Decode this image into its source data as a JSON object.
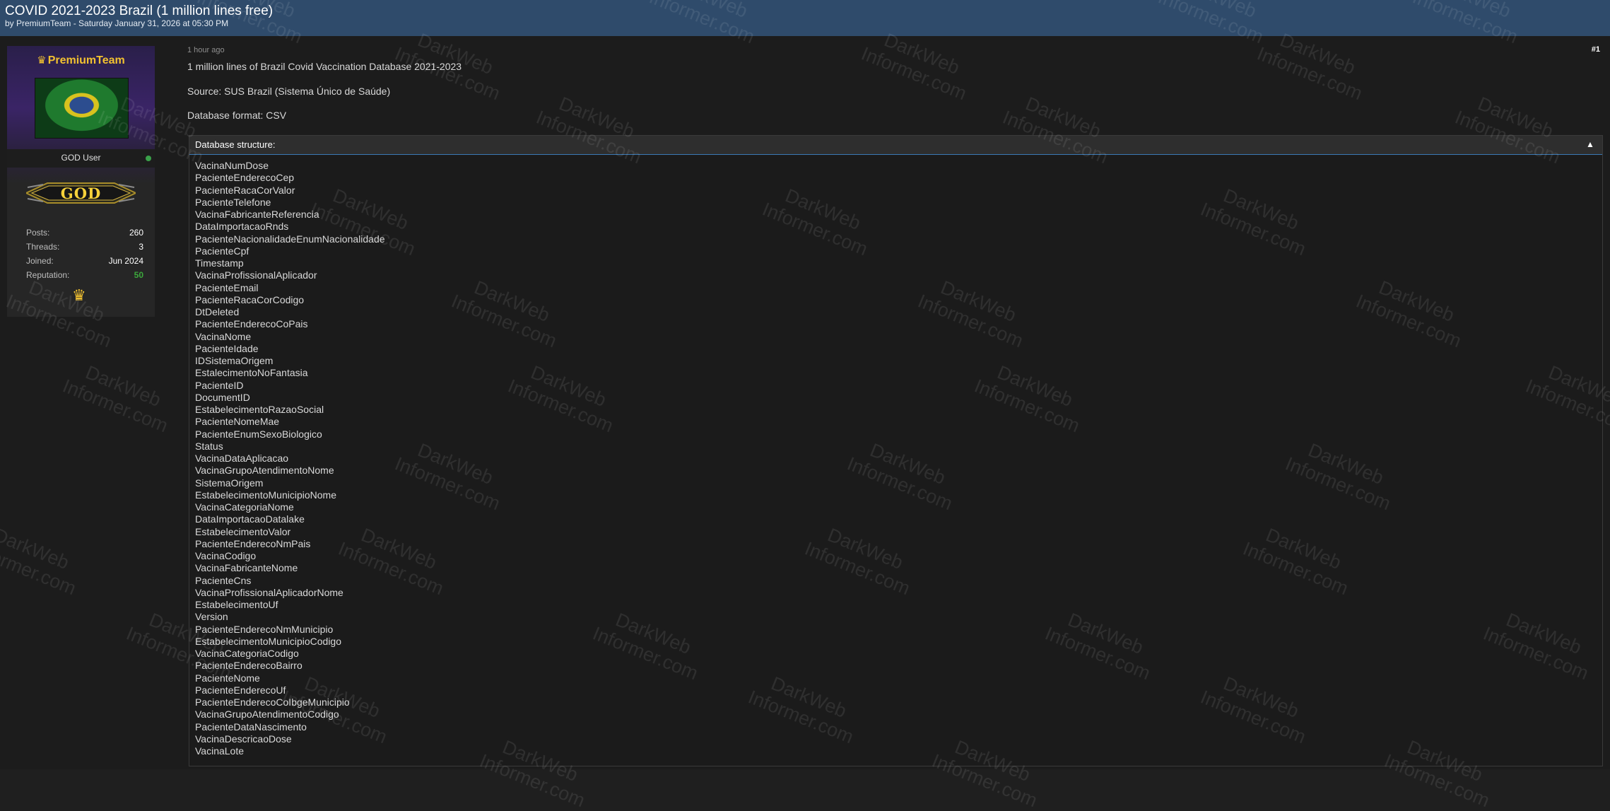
{
  "thread": {
    "title": "COVID 2021-2023 Brazil (1 million lines free)",
    "byline": "by PremiumTeam - Saturday January 31, 2026 at 05:30 PM"
  },
  "user": {
    "crown_icon": "crown-icon",
    "name": "PremiumTeam",
    "rank": "GOD User",
    "badge": "GOD",
    "online_color": "#3aa14a",
    "stats": [
      {
        "label": "Posts:",
        "value": "260"
      },
      {
        "label": "Threads:",
        "value": "3"
      },
      {
        "label": "Joined:",
        "value": "Jun 2024"
      },
      {
        "label": "Reputation:",
        "value": "50"
      }
    ]
  },
  "post": {
    "time": "1 hour ago",
    "number": "#1",
    "lines": [
      "1 million lines of Brazil Covid Vaccination Database 2021-2023",
      "Source: SUS Brazil (Sistema Único de Saúde)",
      "Database format: CSV"
    ],
    "spoiler_title": "Database structure:",
    "fields": [
      "VacinaNumDose",
      "PacienteEnderecoCep",
      "PacienteRacaCorValor",
      "PacienteTelefone",
      "VacinaFabricanteReferencia",
      "DataImportacaoRnds",
      "PacienteNacionalidadeEnumNacionalidade",
      "PacienteCpf",
      "Timestamp",
      "VacinaProfissionalAplicador",
      "PacienteEmail",
      "PacienteRacaCorCodigo",
      "DtDeleted",
      "PacienteEnderecoCoPais",
      "VacinaNome",
      "PacienteIdade",
      "IDSistemaOrigem",
      "EstalecimentoNoFantasia",
      "PacienteID",
      "DocumentID",
      "EstabelecimentoRazaoSocial",
      "PacienteNomeMae",
      "PacienteEnumSexoBiologico",
      "Status",
      "VacinaDataAplicacao",
      "VacinaGrupoAtendimentoNome",
      "SistemaOrigem",
      "EstabelecimentoMunicipioNome",
      "VacinaCategoriaNome",
      "DataImportacaoDatalake",
      "EstabelecimentoValor",
      "PacienteEnderecoNmPais",
      "VacinaCodigo",
      "VacinaFabricanteNome",
      "PacienteCns",
      "VacinaProfissionalAplicadorNome",
      "EstabelecimentoUf",
      "Version",
      "PacienteEnderecoNmMunicipio",
      "EstabelecimentoMunicipioCodigo",
      "VacinaCategoriaCodigo",
      "PacienteEnderecoBairro",
      "PacienteNome",
      "PacienteEnderecoUf",
      "PacienteEnderecoCoIbgeMunicipio",
      "VacinaGrupoAtendimentoCodigo",
      "PacienteDataNascimento",
      "VacinaDescricaoDose",
      "VacinaLote"
    ]
  },
  "watermark": {
    "line1": "DarkWeb",
    "line2": "Informer.com"
  },
  "colors": {
    "header_bg": "#2f4b6b",
    "username": "#f2c230",
    "reputation": "#3ca83c"
  }
}
